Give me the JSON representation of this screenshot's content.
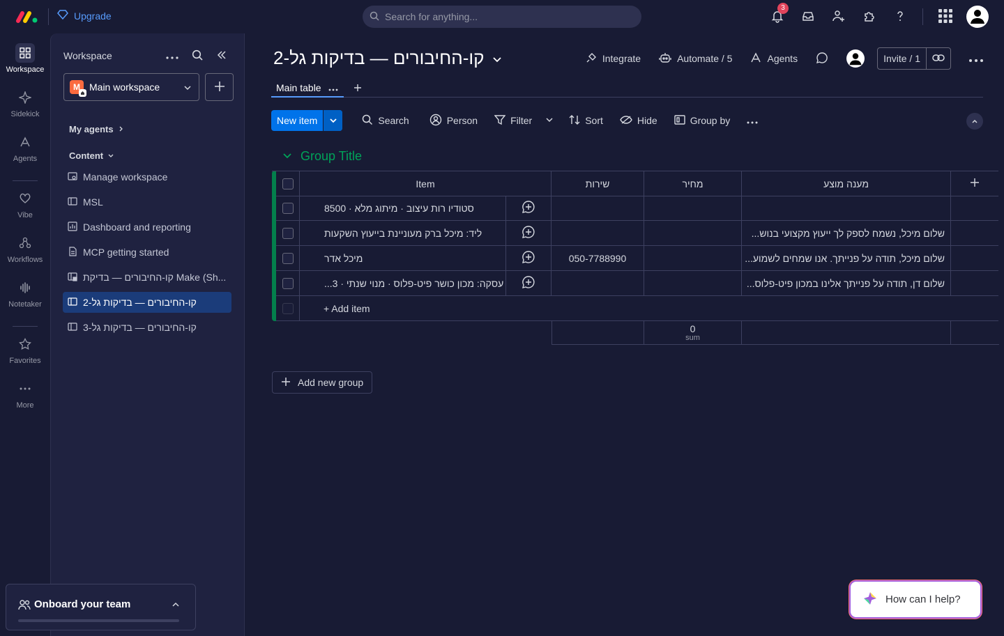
{
  "topbar": {
    "upgrade_label": "Upgrade",
    "search_placeholder": "Search for anything...",
    "notification_count": "3"
  },
  "rail": {
    "items": [
      {
        "label": "Workspace",
        "icon": "grid-icon",
        "active": true
      },
      {
        "label": "Sidekick",
        "icon": "sparkle-icon"
      },
      {
        "label": "Agents",
        "icon": "agents-icon"
      },
      {
        "label": "Vibe",
        "icon": "heart-icon"
      },
      {
        "label": "Workflows",
        "icon": "workflows-icon"
      },
      {
        "label": "Notetaker",
        "icon": "waveform-icon"
      },
      {
        "label": "Favorites",
        "icon": "star-icon"
      },
      {
        "label": "More",
        "icon": "dots-icon"
      }
    ]
  },
  "left_panel": {
    "title": "Workspace",
    "workspace_name": "Main workspace",
    "workspace_initial": "M",
    "my_agents": "My agents",
    "content": "Content",
    "items": [
      {
        "label": "Manage workspace",
        "icon": "settings-board-icon"
      },
      {
        "label": "MSL",
        "icon": "board-icon"
      },
      {
        "label": "Dashboard and reporting",
        "icon": "dashboard-icon"
      },
      {
        "label": "MCP getting started",
        "icon": "doc-icon"
      },
      {
        "label": "קו-החיבורים — בדיקת Make (Sh...",
        "icon": "locked-board-icon"
      },
      {
        "label": "קו-החיבורים — בדיקות גל-2",
        "icon": "board-icon",
        "active": true
      },
      {
        "label": "קו-החיבורים — בדיקות גל-3",
        "icon": "board-icon"
      }
    ],
    "onboard_label": "Onboard your team"
  },
  "board": {
    "title": "קו-החיבורים — בדיקות גל-2",
    "actions": {
      "integrate": "Integrate",
      "automate": "Automate / 5",
      "agents": "Agents",
      "invite": "Invite / 1"
    },
    "tab_label": "Main table",
    "toolbar": {
      "new_item": "New item",
      "search": "Search",
      "person": "Person",
      "filter": "Filter",
      "sort": "Sort",
      "hide": "Hide",
      "group_by": "Group by"
    },
    "group": {
      "title": "Group Title",
      "color": "#00a359",
      "columns": {
        "item": "Item",
        "service": "שירות",
        "price": "מחיר",
        "reply": "מענה מוצע"
      },
      "rows": [
        {
          "item": "סטודיו רות עיצוב · מיתוג מלא · 8500",
          "service": "",
          "price": "",
          "reply": ""
        },
        {
          "item": "ליד: מיכל ברק מעוניינת בייעוץ השקעות",
          "service": "",
          "price": "",
          "reply": "שלום מיכל, נשמח לספק לך ייעוץ מקצועי בנוש..."
        },
        {
          "item": "מיכל אדר",
          "service": "050-7788990",
          "price": "",
          "reply": "שלום מיכל, תודה על פנייתך. אנו שמחים לשמוע..."
        },
        {
          "item": "עסקה: מכון כושר פיט-פלוס · מנוי שנתי · 3...",
          "service": "",
          "price": "",
          "reply": "שלום דן, תודה על פנייתך אלינו במכון פיט-פלוס..."
        }
      ],
      "add_item": "+ Add item",
      "sum_value": "0",
      "sum_label": "sum"
    },
    "add_group": "Add new group"
  },
  "help_label": "How can I help?"
}
